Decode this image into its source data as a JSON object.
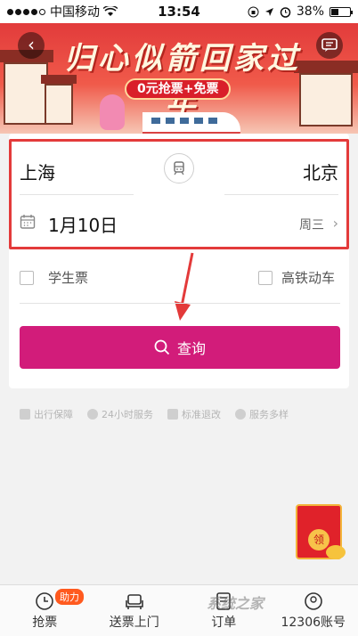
{
  "status_bar": {
    "carrier": "中国移动",
    "time": "13:54",
    "battery": "38%",
    "battery_level": 0.38
  },
  "banner": {
    "title": "归心似箭回家过年",
    "badge": "0元抢票+免票"
  },
  "search": {
    "from": "上海",
    "to": "北京",
    "date": "1月10日",
    "weekday": "周三",
    "options": [
      {
        "label": "学生票",
        "checked": false
      },
      {
        "label": "高铁动车",
        "checked": false
      }
    ],
    "query_label": "查询"
  },
  "features": [
    {
      "label": "出行保障",
      "icon": "shield-icon"
    },
    {
      "label": "24小时服务",
      "icon": "clock-icon"
    },
    {
      "label": "标准退改",
      "icon": "refund-icon"
    },
    {
      "label": "服务多样",
      "icon": "grid-icon"
    }
  ],
  "envelope": {
    "label": "领"
  },
  "tabbar": {
    "tabs": [
      {
        "label": "抢票",
        "badge": "助力",
        "icon": "clock-icon"
      },
      {
        "label": "送票上门",
        "icon": "sofa-icon"
      },
      {
        "label": "订单",
        "icon": "order-icon"
      },
      {
        "label": "12306账号",
        "icon": "account-icon"
      }
    ]
  },
  "watermark": "系统之家",
  "colors": {
    "accent": "#d21c7a",
    "highlight_border": "#e33a3a",
    "banner_red": "#e23b3b"
  }
}
